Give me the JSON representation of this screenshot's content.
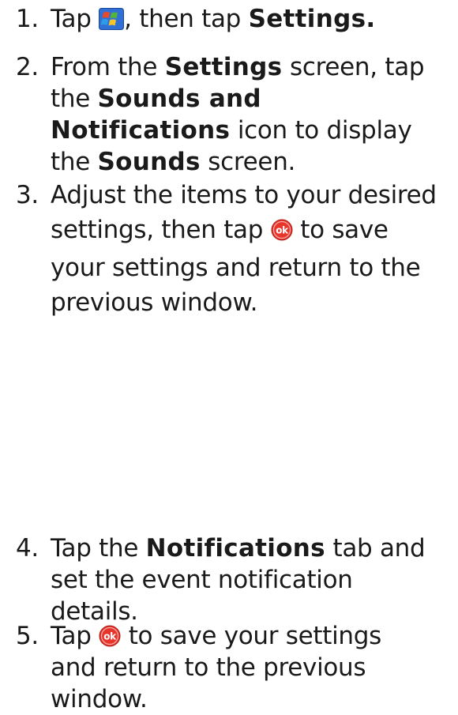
{
  "steps": [
    {
      "number": "1.",
      "lines": [
        {
          "a": "Tap ",
          "b": ", then tap ",
          "kw": "Settings."
        }
      ]
    },
    {
      "number": "2.",
      "lines": [
        {
          "a": "From the ",
          "kw": "Settings",
          "b": " screen, tap"
        },
        {
          "a": "the ",
          "kw": "Sounds and"
        },
        {
          "kw": "Notifications",
          "b": " icon to display"
        },
        {
          "a": "the ",
          "kw": "Sounds",
          "b": " screen."
        }
      ]
    },
    {
      "number": "3.",
      "lines": [
        {
          "text": "Adjust the items to your desired"
        },
        {
          "a": "settings, then tap ",
          "b": " to save"
        },
        {
          "text": "your settings and return to the"
        },
        {
          "text": "previous window."
        }
      ]
    },
    {
      "number": "4.",
      "lines": [
        {
          "a": "Tap the ",
          "kw": "Notifications",
          "b": " tab and"
        },
        {
          "text": "set the event notification"
        },
        {
          "text": "details."
        }
      ]
    },
    {
      "number": "5.",
      "lines": [
        {
          "a": "Tap ",
          "b": " to save your settings"
        },
        {
          "text": "and return to the previous"
        },
        {
          "text": "window."
        }
      ]
    }
  ],
  "icons": {
    "start": "windows-start-icon",
    "ok": "ok-icon"
  },
  "colors": {
    "text": "#1a1a1a",
    "ok_red": "#e8352c",
    "start_blue": "#2f6fd6"
  }
}
